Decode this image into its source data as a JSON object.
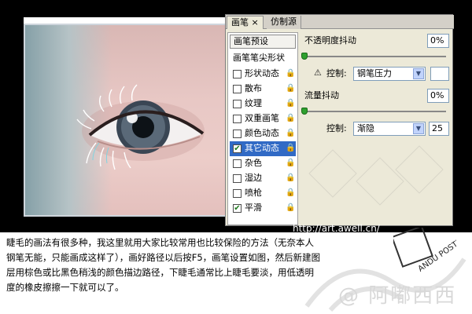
{
  "panel": {
    "tab_active": "画笔 ×",
    "tab_inactive": "仿制源",
    "preset_button": "画笔预设",
    "tip_button": "画笔笔尖形状",
    "items": [
      {
        "label": "形状动态",
        "checked": false
      },
      {
        "label": "散布",
        "checked": false
      },
      {
        "label": "纹理",
        "checked": false
      },
      {
        "label": "双重画笔",
        "checked": false
      },
      {
        "label": "颜色动态",
        "checked": false
      },
      {
        "label": "其它动态",
        "checked": true,
        "selected": true
      },
      {
        "label": "杂色",
        "checked": false
      },
      {
        "label": "湿边",
        "checked": false
      },
      {
        "label": "喷枪",
        "checked": false
      },
      {
        "label": "平滑",
        "checked": true
      }
    ],
    "opacity_jitter_label": "不透明度抖动",
    "opacity_jitter_value": "0%",
    "control_label": "控制:",
    "control1_value": "钢笔压力",
    "flow_jitter_label": "流量抖动",
    "flow_jitter_value": "0%",
    "control2_value": "渐隐",
    "control2_number": "25"
  },
  "url": "http://art.awell.cn/",
  "caption": "睫毛的画法有很多种，我这里就用大家比较常用也比较保险的方法（无奈本人钢笔无能，只能画成这样了），画好路径以后按F5，画笔设置如图，然后新建图层用棕色或比黑色稍浅的颜色描边路径，下睫毛通常比上睫毛要淡，用低透明度的橡皮擦擦一下就可以了。",
  "watermark": {
    "seal_text": "ANDU POSTER",
    "brand_text": "@ 阿嘟西西"
  },
  "icons": {
    "lock": "lock-icon",
    "warning": "warning-icon",
    "dropdown": "chevron-down-icon"
  }
}
